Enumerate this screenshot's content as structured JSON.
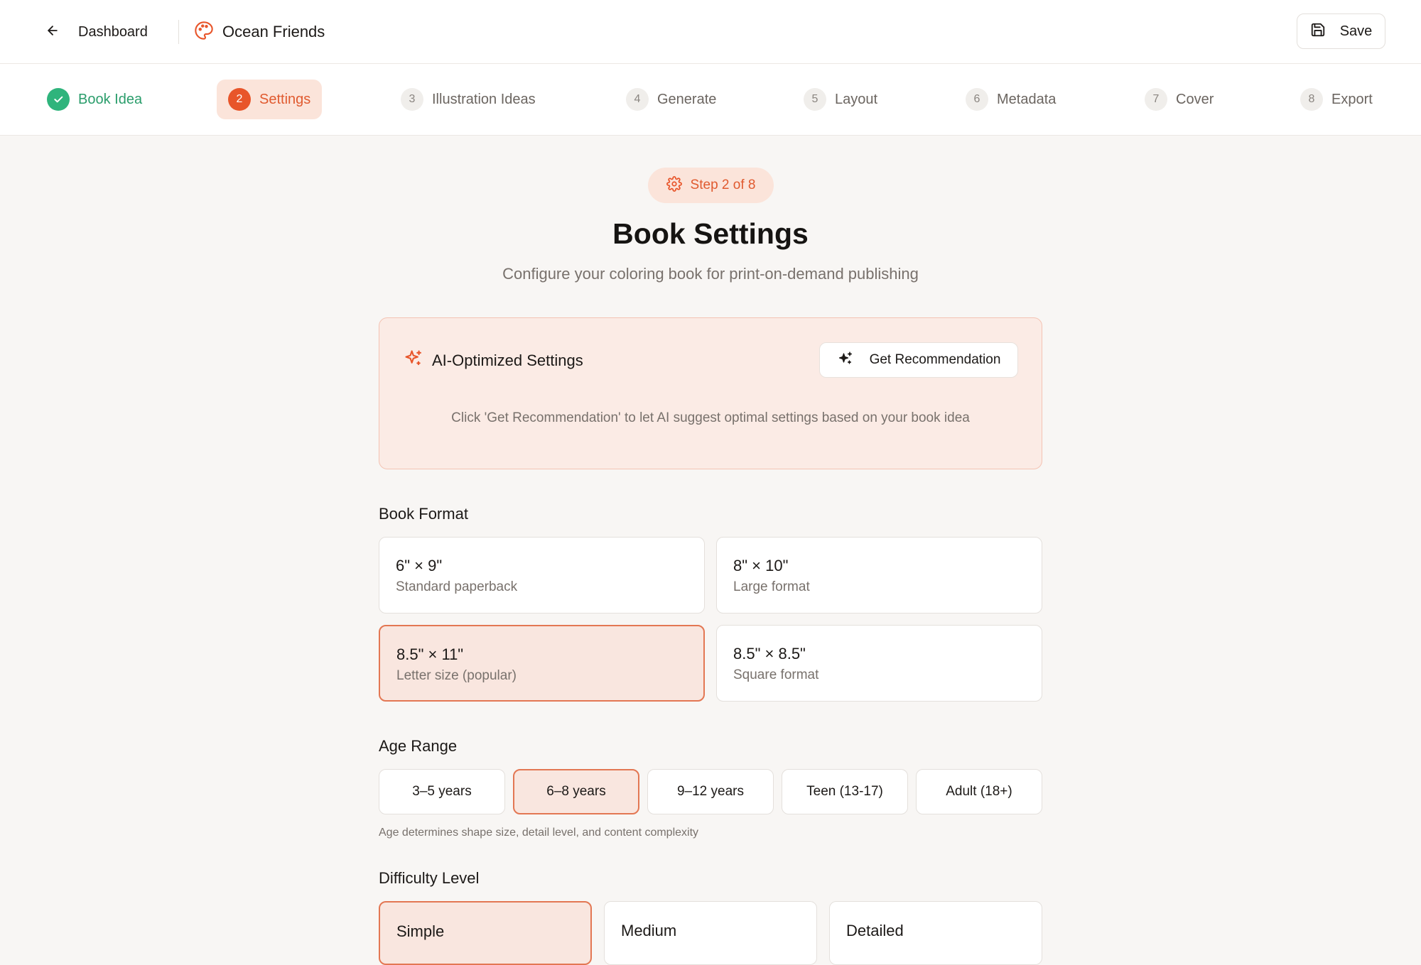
{
  "header": {
    "back_label": "Dashboard",
    "project_name": "Ocean Friends",
    "save_label": "Save"
  },
  "stepper": {
    "steps": [
      {
        "number": "✓",
        "label": "Book Idea",
        "state": "completed"
      },
      {
        "number": "2",
        "label": "Settings",
        "state": "active"
      },
      {
        "number": "3",
        "label": "Illustration Ideas",
        "state": "pending"
      },
      {
        "number": "4",
        "label": "Generate",
        "state": "pending"
      },
      {
        "number": "5",
        "label": "Layout",
        "state": "pending"
      },
      {
        "number": "6",
        "label": "Metadata",
        "state": "pending"
      },
      {
        "number": "7",
        "label": "Cover",
        "state": "pending"
      },
      {
        "number": "8",
        "label": "Export",
        "state": "pending"
      }
    ]
  },
  "main": {
    "step_badge": "Step 2 of 8",
    "title": "Book Settings",
    "subtitle": "Configure your coloring book for print-on-demand publishing"
  },
  "ai_card": {
    "title": "AI-Optimized Settings",
    "button_label": "Get Recommendation",
    "hint": "Click 'Get Recommendation' to let AI suggest optimal settings based on your book idea"
  },
  "book_format": {
    "label": "Book Format",
    "options": [
      {
        "title": "6\" × 9\"",
        "subtitle": "Standard paperback",
        "selected": false
      },
      {
        "title": "8\" × 10\"",
        "subtitle": "Large format",
        "selected": false
      },
      {
        "title": "8.5\" × 11\"",
        "subtitle": "Letter size (popular)",
        "selected": true
      },
      {
        "title": "8.5\" × 8.5\"",
        "subtitle": "Square format",
        "selected": false
      }
    ]
  },
  "age_range": {
    "label": "Age Range",
    "options": [
      {
        "label": "3–5 years",
        "selected": false
      },
      {
        "label": "6–8 years",
        "selected": true
      },
      {
        "label": "9–12 years",
        "selected": false
      },
      {
        "label": "Teen (13-17)",
        "selected": false
      },
      {
        "label": "Adult (18+)",
        "selected": false
      }
    ],
    "note": "Age determines shape size, detail level, and content complexity"
  },
  "difficulty": {
    "label": "Difficulty Level",
    "options": [
      {
        "label": "Simple",
        "selected": true
      },
      {
        "label": "Medium",
        "selected": false
      },
      {
        "label": "Detailed",
        "selected": false
      }
    ]
  },
  "colors": {
    "accent": "#e8552a",
    "success": "#2fb47c",
    "selected_bg": "#f9e6df"
  },
  "icons": {
    "back": "arrow-left-icon",
    "project": "palette-icon",
    "save": "floppy-disk-icon",
    "badge": "gear-icon",
    "ai": "sparkles-icon"
  }
}
